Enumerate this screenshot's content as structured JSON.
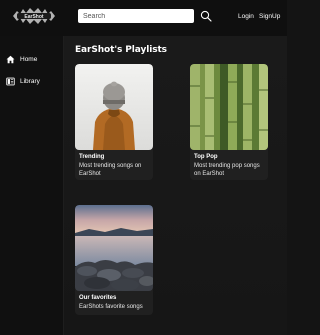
{
  "header": {
    "logo_text": "EarShot",
    "search_placeholder": "Search",
    "login_label": "Login",
    "signup_label": "SignUp"
  },
  "sidebar": {
    "items": [
      {
        "label": "Home",
        "icon": "home-icon"
      },
      {
        "label": "Library",
        "icon": "library-icon"
      }
    ]
  },
  "main": {
    "section_title": "EarShot's Playlists",
    "playlists": [
      {
        "title": "Trending",
        "description": "Most trending songs on EarShot",
        "image": "person-beanie-image"
      },
      {
        "title": "Top Pop",
        "description": "Most trending pop songs on EarShot",
        "image": "bamboo-image"
      },
      {
        "title": "Our favorites",
        "description": "EarShots favorite songs",
        "image": "lake-rocks-image"
      }
    ]
  }
}
